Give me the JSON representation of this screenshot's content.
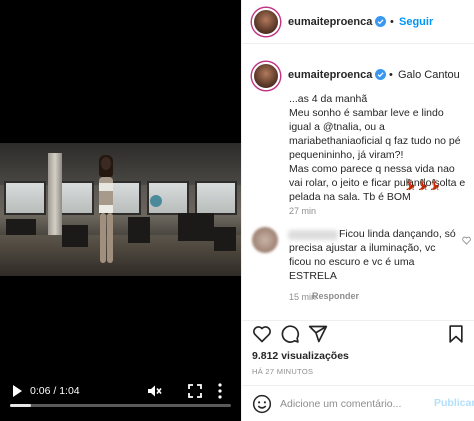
{
  "video": {
    "time": "0:06 / 1:04",
    "progress_fraction": 0.094,
    "icons": {
      "play": "play-icon",
      "mute": "volume-muted-icon",
      "fullscreen": "fullscreen-icon",
      "more": "more-vertical-icon"
    }
  },
  "header": {
    "username": "eumaiteproenca",
    "separator": "•",
    "follow_label": "Seguir",
    "more_label": "•••"
  },
  "caption": {
    "username": "eumaiteproenca",
    "separator": "•",
    "audio_label": "Galo Cantou",
    "text": "...as 4 da manhã\nMeu sonho é sambar leve e lindo igual a @tnalia, ou a mariabethaniaoficial q faz tudo no pé pequenininho, já viram?!\nMas como parece q nessa vida nao vai rolar, o jeito e ficar pulando solta e pelada na sala. Tb é BOM",
    "time": "27 min"
  },
  "comment": {
    "text": "Ficou linda dançando, só precisa ajustar a iluminação, vc ficou no escuro e vc é uma ESTRELA",
    "time": "15 min",
    "reply_label": "Responder"
  },
  "actions": {
    "views": "9.812 visualizações",
    "ago": "HÁ 27 MINUTOS"
  },
  "comment_box": {
    "placeholder": "Adicione um comentário...",
    "post_label": "Publicar"
  },
  "colors": {
    "accent": "#0095f6",
    "post_disabled": "#b2dffc",
    "verified": "#3897f0"
  }
}
